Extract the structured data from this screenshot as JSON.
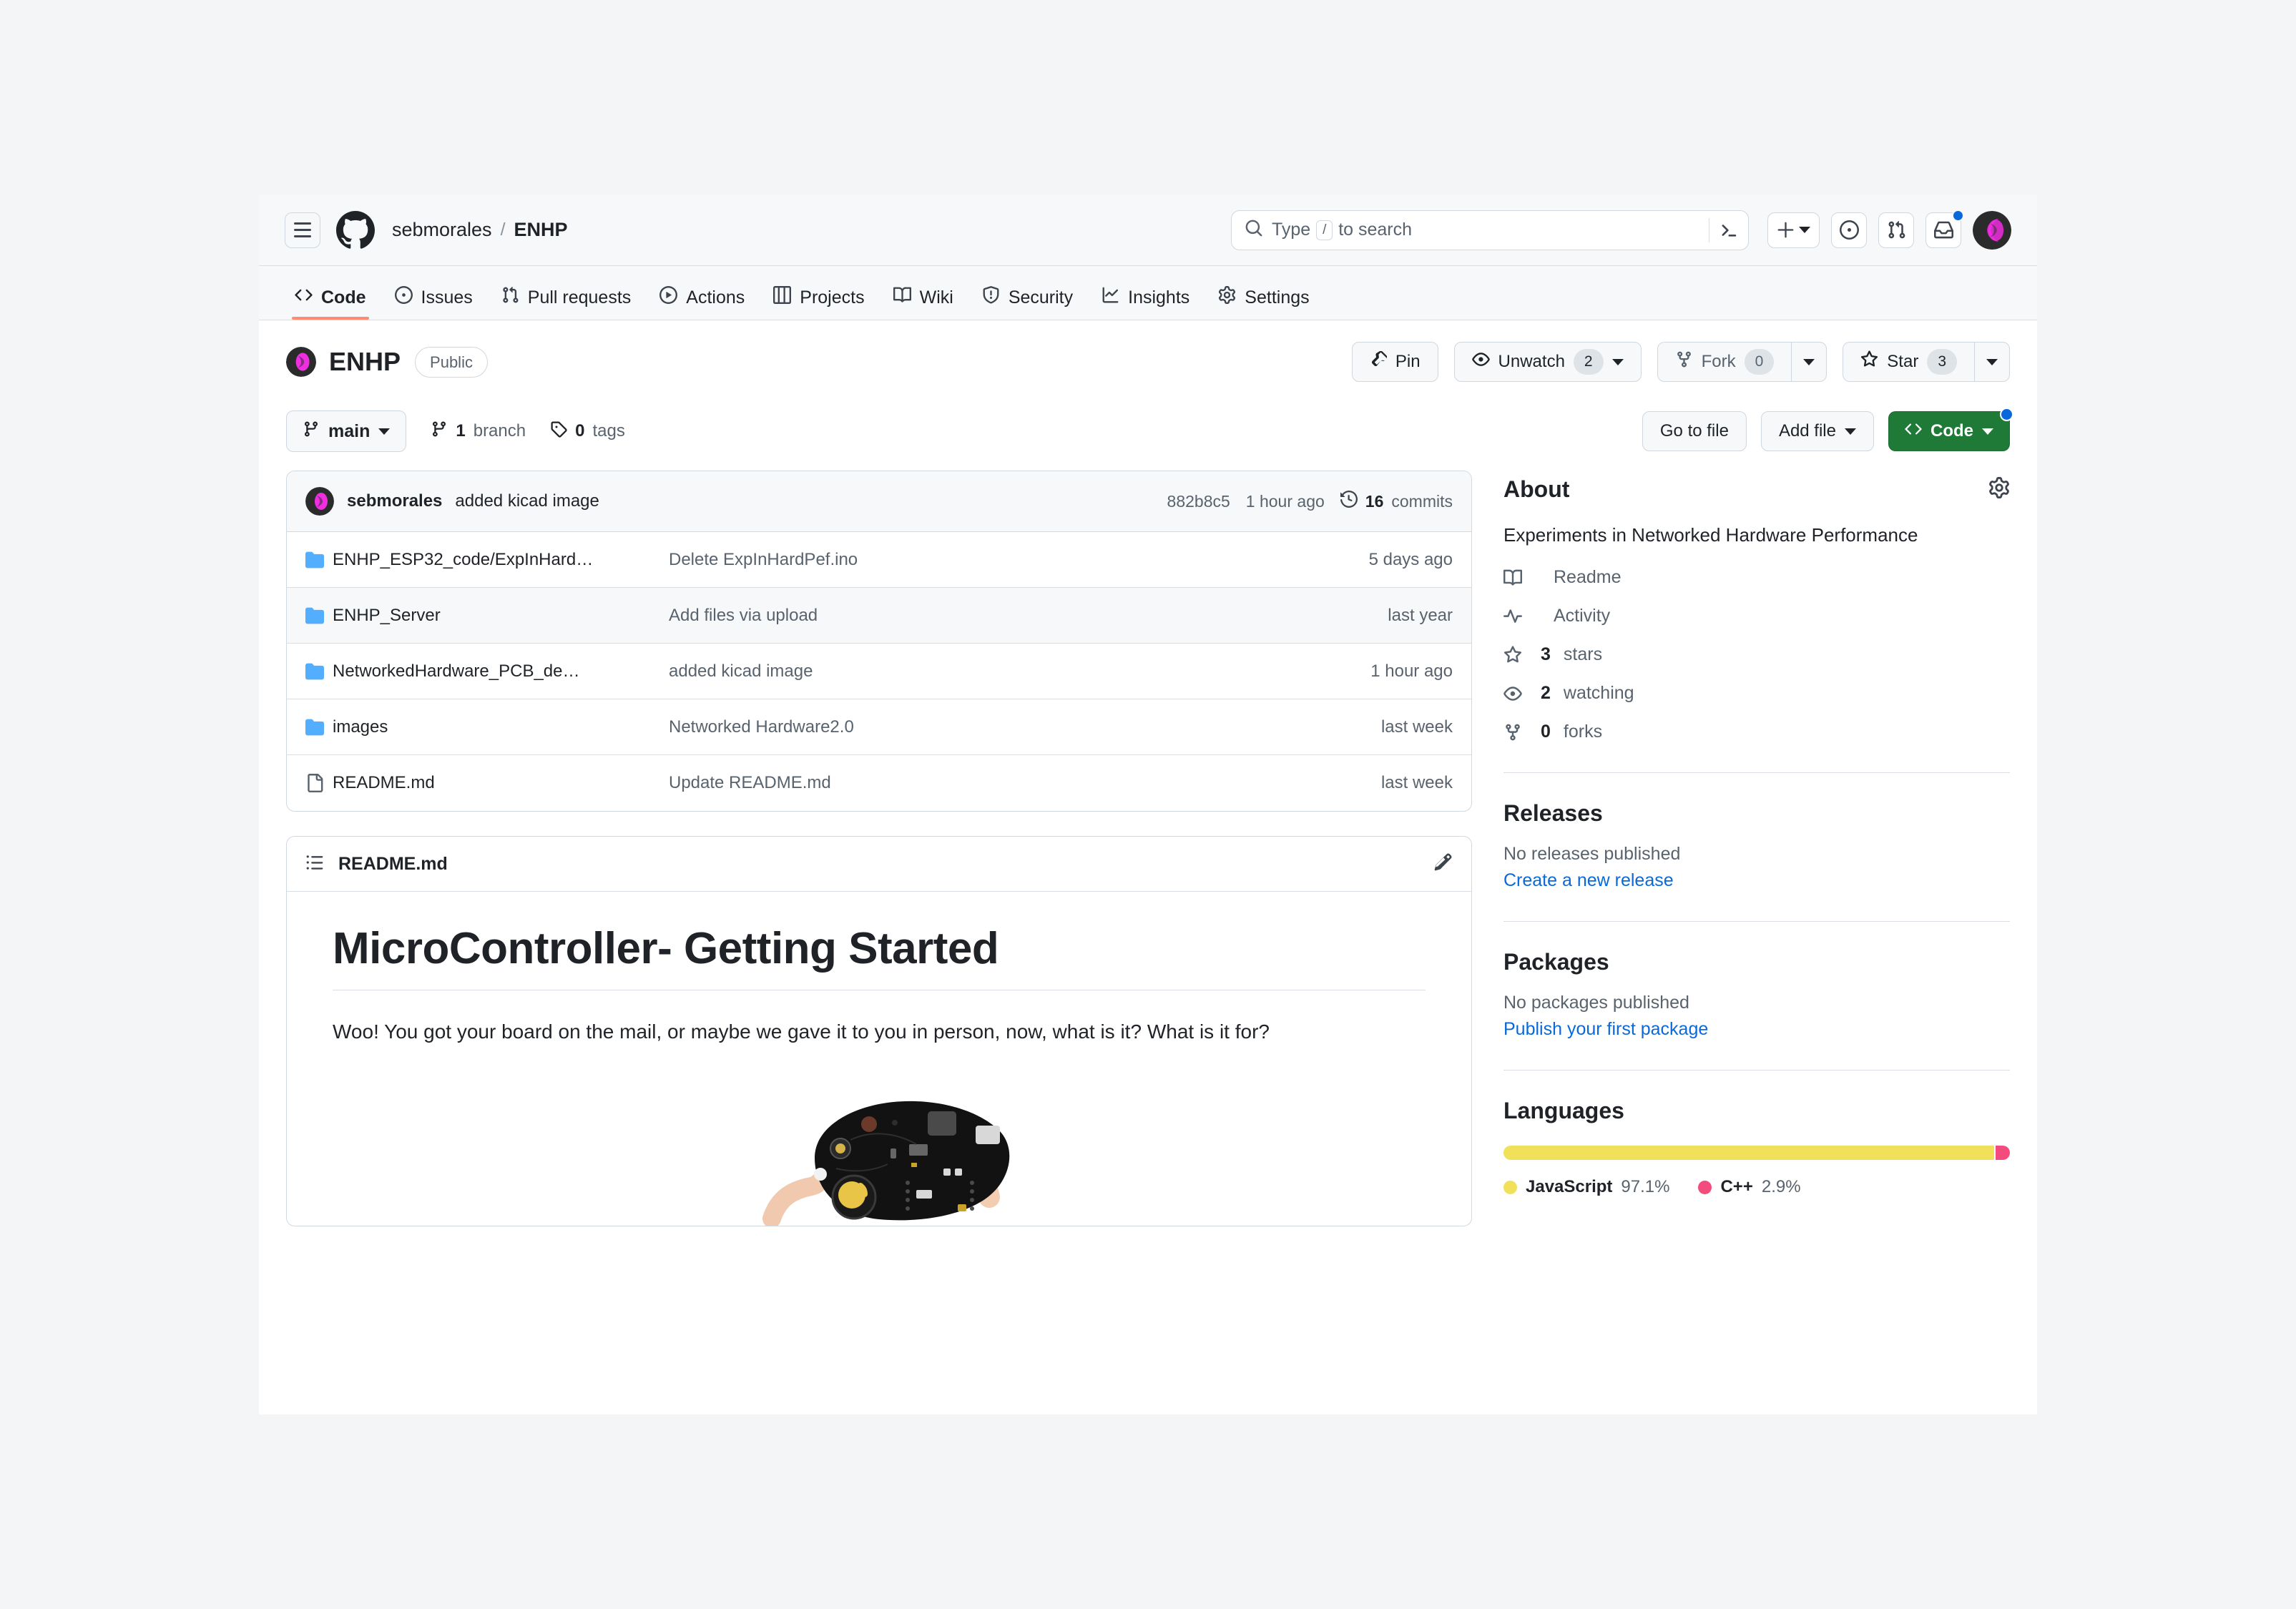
{
  "header": {
    "menu_icon": "hamburger-icon",
    "logo_icon": "github-mark-icon",
    "owner": "sebmorales",
    "separator": "/",
    "repo": "ENHP",
    "search": {
      "icon": "search-icon",
      "placeholder_before": "Type",
      "slash_key": "/",
      "placeholder_after": "to search",
      "terminal_icon": "command-palette-icon"
    },
    "create_new_label": "create-new-button",
    "issues_icon": "issues-dot-icon",
    "pulls_icon": "pull-request-icon",
    "inbox_icon": "inbox-icon",
    "avatar": "user-avatar"
  },
  "nav": {
    "tabs": [
      {
        "label": "Code",
        "icon": "code-icon",
        "active": true
      },
      {
        "label": "Issues",
        "icon": "issue-opened-icon",
        "active": false
      },
      {
        "label": "Pull requests",
        "icon": "git-pull-request-icon",
        "active": false
      },
      {
        "label": "Actions",
        "icon": "play-icon",
        "active": false
      },
      {
        "label": "Projects",
        "icon": "table-icon",
        "active": false
      },
      {
        "label": "Wiki",
        "icon": "book-icon",
        "active": false
      },
      {
        "label": "Security",
        "icon": "shield-icon",
        "active": false
      },
      {
        "label": "Insights",
        "icon": "graph-icon",
        "active": false
      },
      {
        "label": "Settings",
        "icon": "gear-icon",
        "active": false
      }
    ]
  },
  "repo": {
    "name": "ENHP",
    "visibility": "Public",
    "actions": {
      "pin": "Pin",
      "watch": "Unwatch",
      "watch_count": "2",
      "fork": "Fork",
      "fork_count": "0",
      "star": "Star",
      "star_count": "3"
    }
  },
  "file_toolbar": {
    "branch": "main",
    "branch_count": "1",
    "branch_word": "branch",
    "tag_count": "0",
    "tag_word": "tags",
    "go_to_file": "Go to file",
    "add_file": "Add file",
    "code": "Code"
  },
  "latest_commit": {
    "author": "sebmorales",
    "message": "added kicad image",
    "sha": "882b8c5",
    "time": "1 hour ago",
    "commits_count": "16",
    "commits_word": "commits",
    "history_icon": "history-icon"
  },
  "files": [
    {
      "type": "folder",
      "name": "ENHP_ESP32_code/ExpInHard…",
      "message": "Delete ExpInHardPef.ino",
      "age": "5 days ago",
      "alt": false
    },
    {
      "type": "folder",
      "name": "ENHP_Server",
      "message": "Add files via upload",
      "age": "last year",
      "alt": true
    },
    {
      "type": "folder",
      "name": "NetworkedHardware_PCB_de…",
      "message": "added kicad image",
      "age": "1 hour ago",
      "alt": false
    },
    {
      "type": "folder",
      "name": "images",
      "message": "Networked Hardware2.0",
      "age": "last week",
      "alt": false
    },
    {
      "type": "file",
      "name": "README.md",
      "message": "Update README.md",
      "age": "last week",
      "alt": false
    }
  ],
  "readme": {
    "tab_title": "README.md",
    "list_icon": "list-unordered-icon",
    "edit_icon": "pencil-icon",
    "heading": "MicroController- Getting Started",
    "paragraph": "Woo! You got your board on the mail, or maybe we gave it to you in person, now, what is it? What is it for?",
    "image_alt": "black pcb microcontroller board held in hand"
  },
  "about": {
    "title": "About",
    "gear_icon": "gear-icon",
    "description": "Experiments in Networked Hardware Performance",
    "links": [
      {
        "label": "Readme",
        "icon": "book-icon",
        "bold": ""
      },
      {
        "label": "Activity",
        "icon": "pulse-icon",
        "bold": ""
      },
      {
        "label": "stars",
        "icon": "star-icon",
        "bold": "3"
      },
      {
        "label": "watching",
        "icon": "eye-icon",
        "bold": "2"
      },
      {
        "label": "forks",
        "icon": "fork-icon",
        "bold": "0"
      }
    ]
  },
  "releases": {
    "title": "Releases",
    "empty": "No releases published",
    "action": "Create a new release"
  },
  "packages": {
    "title": "Packages",
    "empty": "No packages published",
    "action": "Publish your first package"
  },
  "languages": {
    "title": "Languages",
    "items": [
      {
        "name": "JavaScript",
        "pct": "97.1%",
        "value": 97.1,
        "color": "#f1e05a"
      },
      {
        "name": "C++",
        "pct": "2.9%",
        "value": 2.9,
        "color": "#f34b7d"
      }
    ]
  },
  "colors": {
    "accent_green": "#1f7a37",
    "link_blue": "#0969da",
    "active_tab": "#fd8c73",
    "folder_blue": "#54aeff"
  }
}
